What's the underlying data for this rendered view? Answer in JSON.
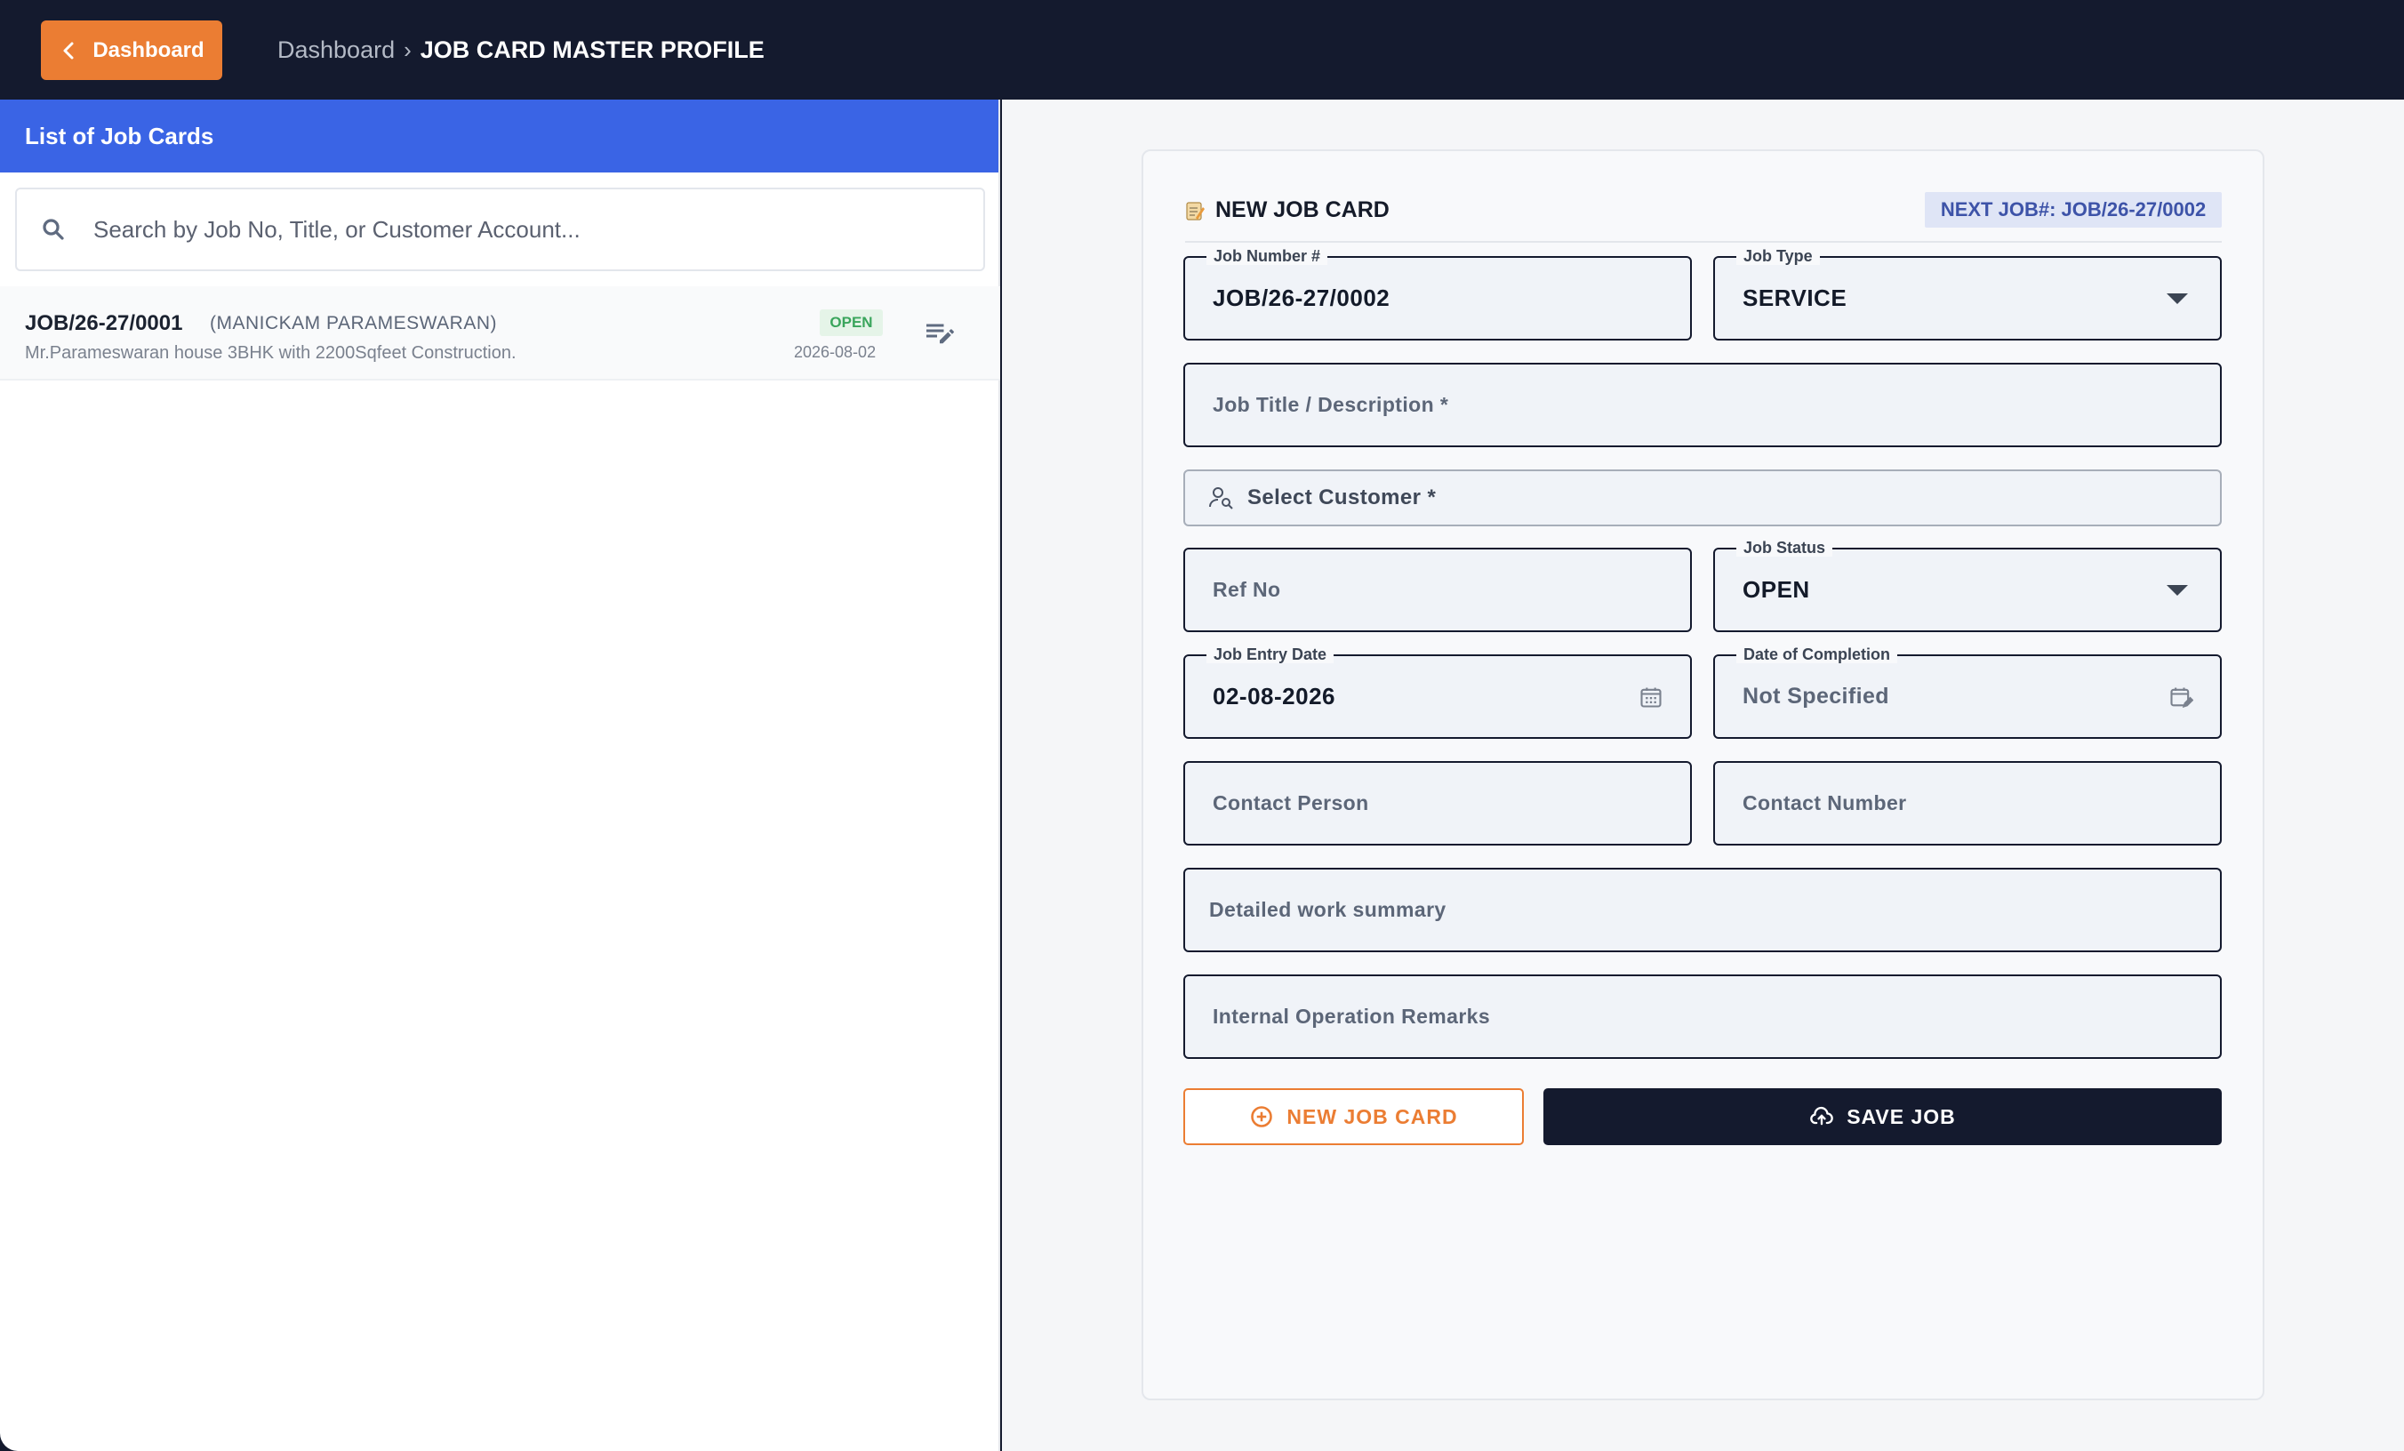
{
  "header": {
    "back_label": "Dashboard",
    "breadcrumb_link": "Dashboard",
    "breadcrumb_sep": "›",
    "breadcrumb_current": "JOB CARD MASTER PROFILE"
  },
  "list": {
    "title": "List of Job Cards",
    "search_placeholder": "Search by Job No, Title, or Customer Account...",
    "items": [
      {
        "job_no": "JOB/26-27/0001",
        "customer": "(MANICKAM PARAMESWARAN)",
        "description": "Mr.Parameswaran house 3BHK with 2200Sqfeet Construction.",
        "status": "OPEN",
        "date": "2026-08-02"
      }
    ]
  },
  "form": {
    "title": "NEW JOB CARD",
    "next_job": "NEXT JOB#: JOB/26-27/0002",
    "job_number_label": "Job Number #",
    "job_number_value": "JOB/26-27/0002",
    "job_type_label": "Job Type",
    "job_type_value": "SERVICE",
    "job_title_placeholder": "Job Title / Description *",
    "customer_placeholder": "Select Customer *",
    "ref_no_placeholder": "Ref No",
    "job_status_label": "Job Status",
    "job_status_value": "OPEN",
    "entry_date_label": "Job Entry Date",
    "entry_date_value": "02-08-2026",
    "completion_label": "Date of Completion",
    "completion_value": "Not Specified",
    "contact_person_placeholder": "Contact Person",
    "contact_number_placeholder": "Contact Number",
    "summary_placeholder": "Detailed work summary",
    "remarks_placeholder": "Internal Operation Remarks",
    "new_button": "NEW JOB CARD",
    "save_button": "SAVE JOB"
  },
  "colors": {
    "accent_orange": "#eb7d33",
    "header_navy": "#141a2e",
    "list_header_blue": "#3a64e5",
    "status_green": "#3aa55c"
  }
}
